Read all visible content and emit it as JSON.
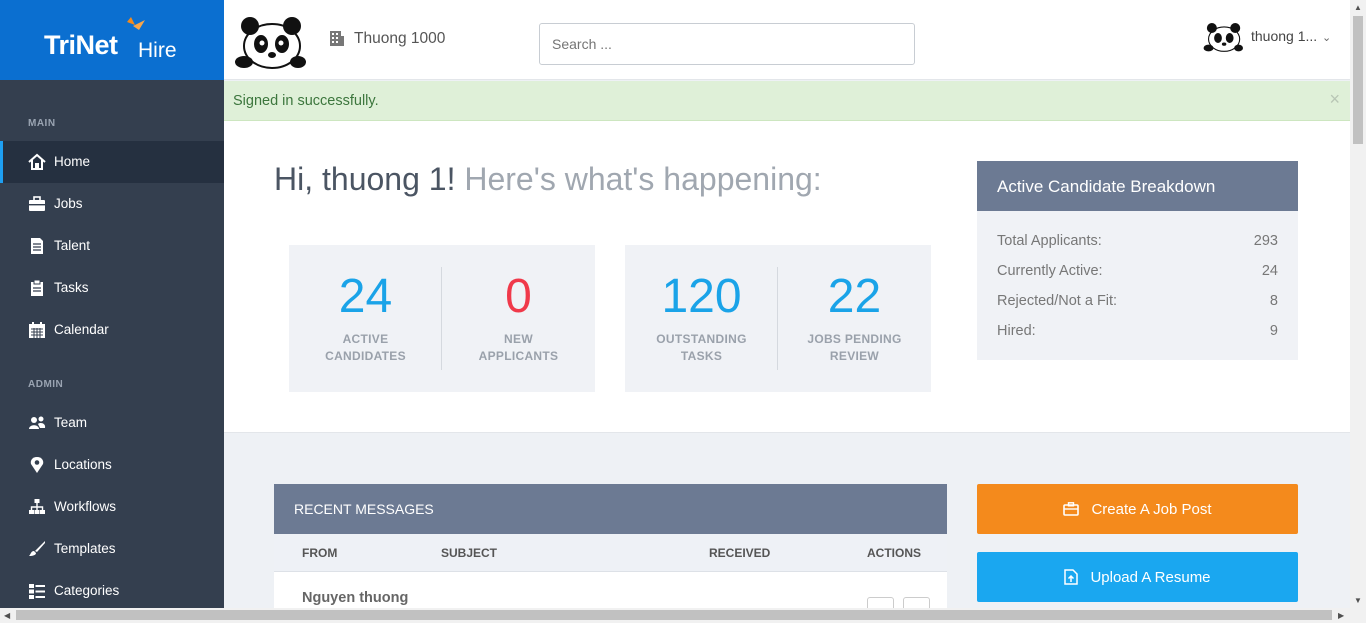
{
  "brand": {
    "name": "TriNet",
    "product": "Hire"
  },
  "header": {
    "company": "Thuong 1000",
    "search_placeholder": "Search ...",
    "user_name": "thuong 1...",
    "user_chevron": "⌄"
  },
  "alert": {
    "message": "Signed in successfully.",
    "close": "×"
  },
  "sidebar": {
    "main_label": "MAIN",
    "admin_label": "ADMIN",
    "main_items": [
      {
        "label": "Home",
        "icon": "home-icon"
      },
      {
        "label": "Jobs",
        "icon": "briefcase-icon"
      },
      {
        "label": "Talent",
        "icon": "document-icon"
      },
      {
        "label": "Tasks",
        "icon": "clipboard-icon"
      },
      {
        "label": "Calendar",
        "icon": "calendar-icon"
      }
    ],
    "admin_items": [
      {
        "label": "Team",
        "icon": "team-icon"
      },
      {
        "label": "Locations",
        "icon": "location-pin-icon"
      },
      {
        "label": "Workflows",
        "icon": "sitemap-icon"
      },
      {
        "label": "Templates",
        "icon": "brush-icon"
      },
      {
        "label": "Categories",
        "icon": "list-icon"
      }
    ]
  },
  "greeting": {
    "hi": "Hi, thuong 1!",
    "sub": "Here's what's happening:"
  },
  "stats": [
    {
      "value": "24",
      "line1": "ACTIVE",
      "line2": "CANDIDATES",
      "color": "#1aa3e8"
    },
    {
      "value": "0",
      "line1": "NEW",
      "line2": "APPLICANTS",
      "color": "#f0394a"
    },
    {
      "value": "120",
      "line1": "OUTSTANDING",
      "line2": "TASKS",
      "color": "#1aa3e8"
    },
    {
      "value": "22",
      "line1": "JOBS PENDING",
      "line2": "REVIEW",
      "color": "#1aa3e8"
    }
  ],
  "breakdown": {
    "title": "Active Candidate Breakdown",
    "rows": [
      {
        "label": "Total Applicants:",
        "value": "293"
      },
      {
        "label": "Currently Active:",
        "value": "24"
      },
      {
        "label": "Rejected/Not a Fit:",
        "value": "8"
      },
      {
        "label": "Hired:",
        "value": "9"
      }
    ]
  },
  "messages": {
    "title": "RECENT MESSAGES",
    "columns": [
      "FROM",
      "SUBJECT",
      "RECEIVED",
      "ACTIONS"
    ],
    "rows": [
      {
        "from": "Nguyen thuong"
      }
    ]
  },
  "actions": {
    "create_job": "Create A Job Post",
    "upload_resume": "Upload A Resume"
  },
  "colors": {
    "brand_blue": "#0b6fd0",
    "sidebar": "#343f4f",
    "accent_orange": "#f48a1c",
    "accent_cyan": "#1aa7f0",
    "stat_blue": "#1aa3e8",
    "stat_red": "#f0394a"
  }
}
